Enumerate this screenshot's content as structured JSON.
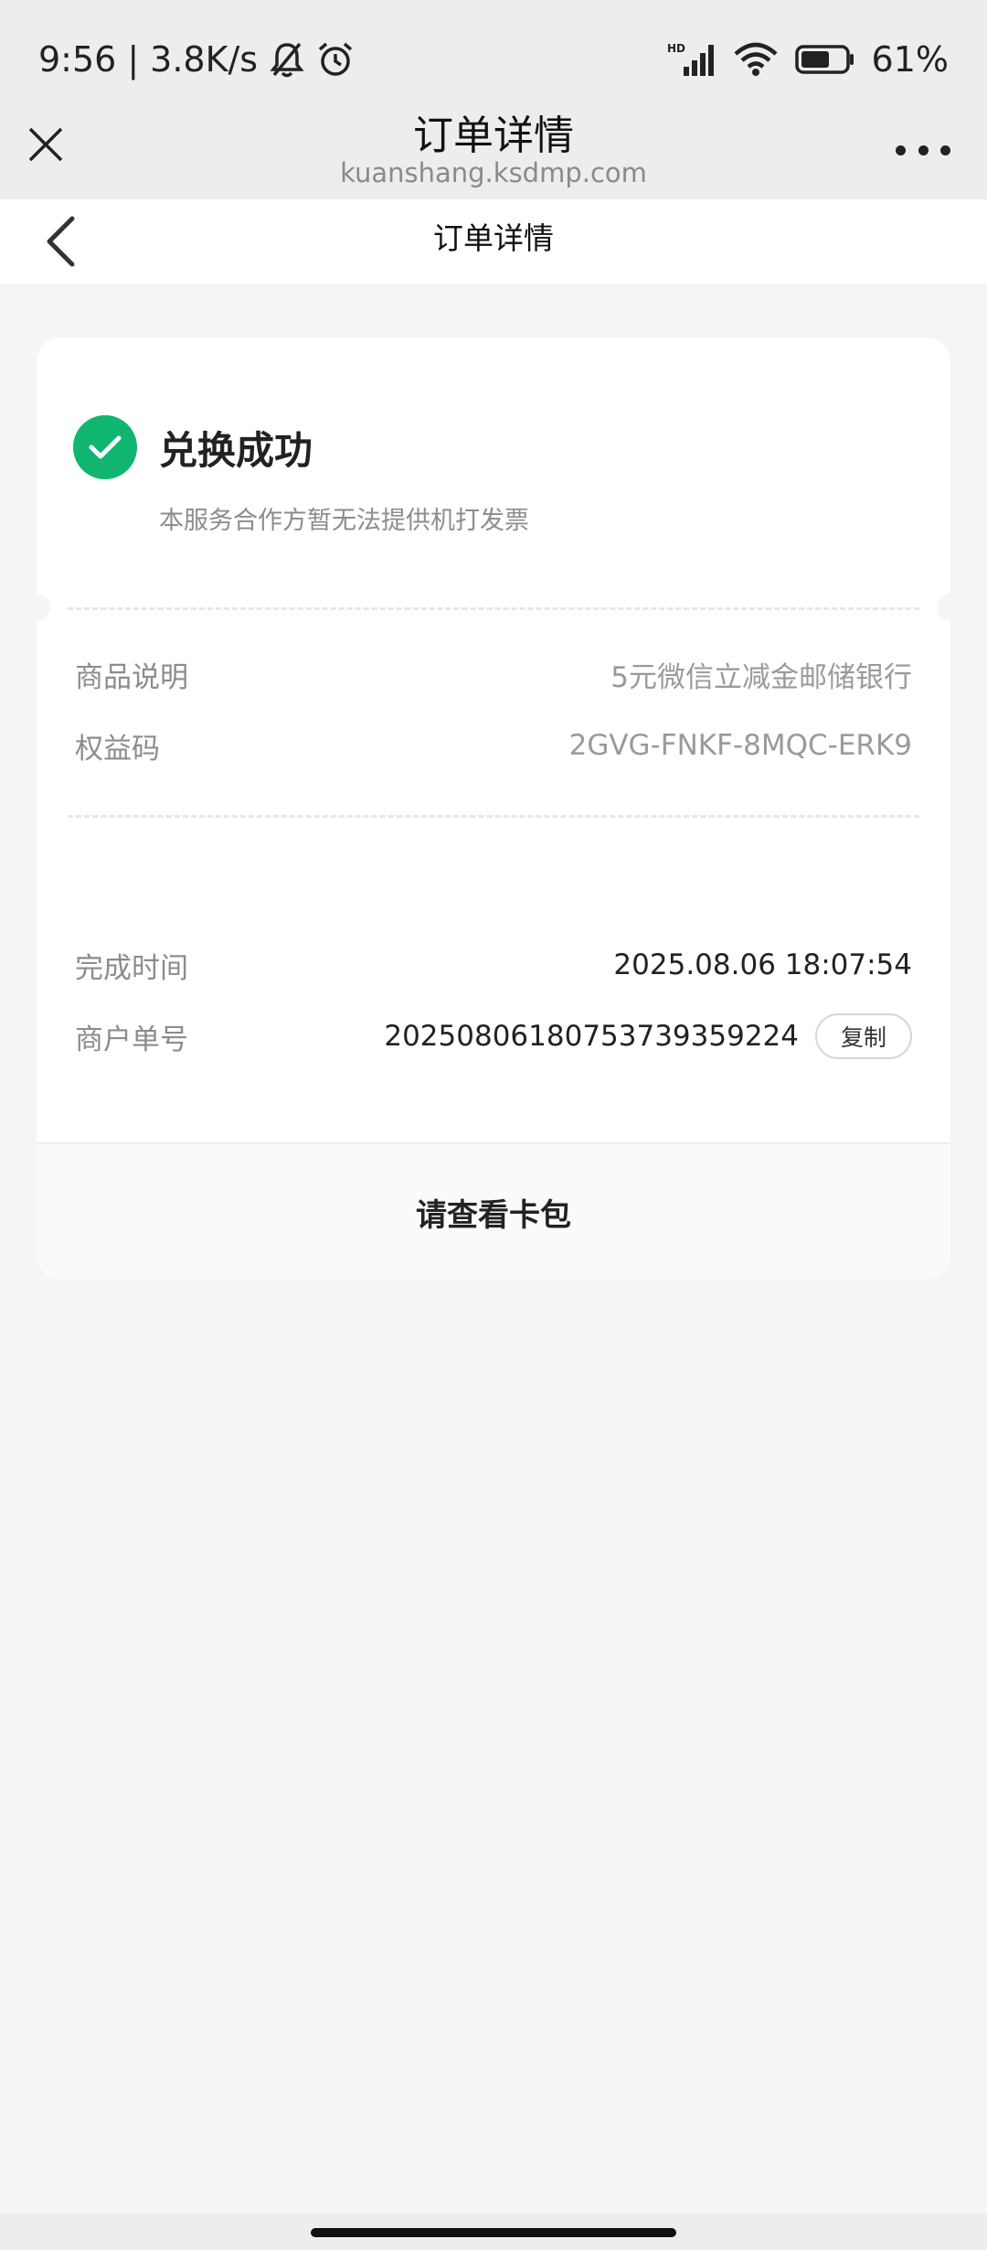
{
  "status_bar": {
    "time": "9:56",
    "network_speed": "3.8K/s",
    "battery": "61%",
    "icons": [
      "bell-mute-icon",
      "alarm-icon",
      "hd-signal-icon",
      "wifi-icon",
      "battery-icon"
    ]
  },
  "webview": {
    "title": "订单详情",
    "url": "kuanshang.ksdmp.com",
    "icons": [
      "close-icon",
      "more-icon"
    ]
  },
  "page": {
    "title": "订单详情",
    "icons": [
      "back-chevron-icon"
    ]
  },
  "order": {
    "status_title": "兑换成功",
    "status_note": "本服务合作方暂无法提供机打发票",
    "product_label": "商品说明",
    "product_value": "5元微信立减金邮储银行",
    "code_label": "权益码",
    "code_value": "2GVG-FNKF-8MQC-ERK9",
    "completion_label": "完成时间",
    "completion_value": "2025.08.06 18:07:54",
    "merchant_label": "商户单号",
    "merchant_value": "20250806180753739359224",
    "copy_label": "复制",
    "footer_text": "请查看卡包"
  },
  "colors": {
    "success": "#10b572",
    "chrome_bg": "#ededed",
    "page_bg": "#f5f5f5"
  }
}
